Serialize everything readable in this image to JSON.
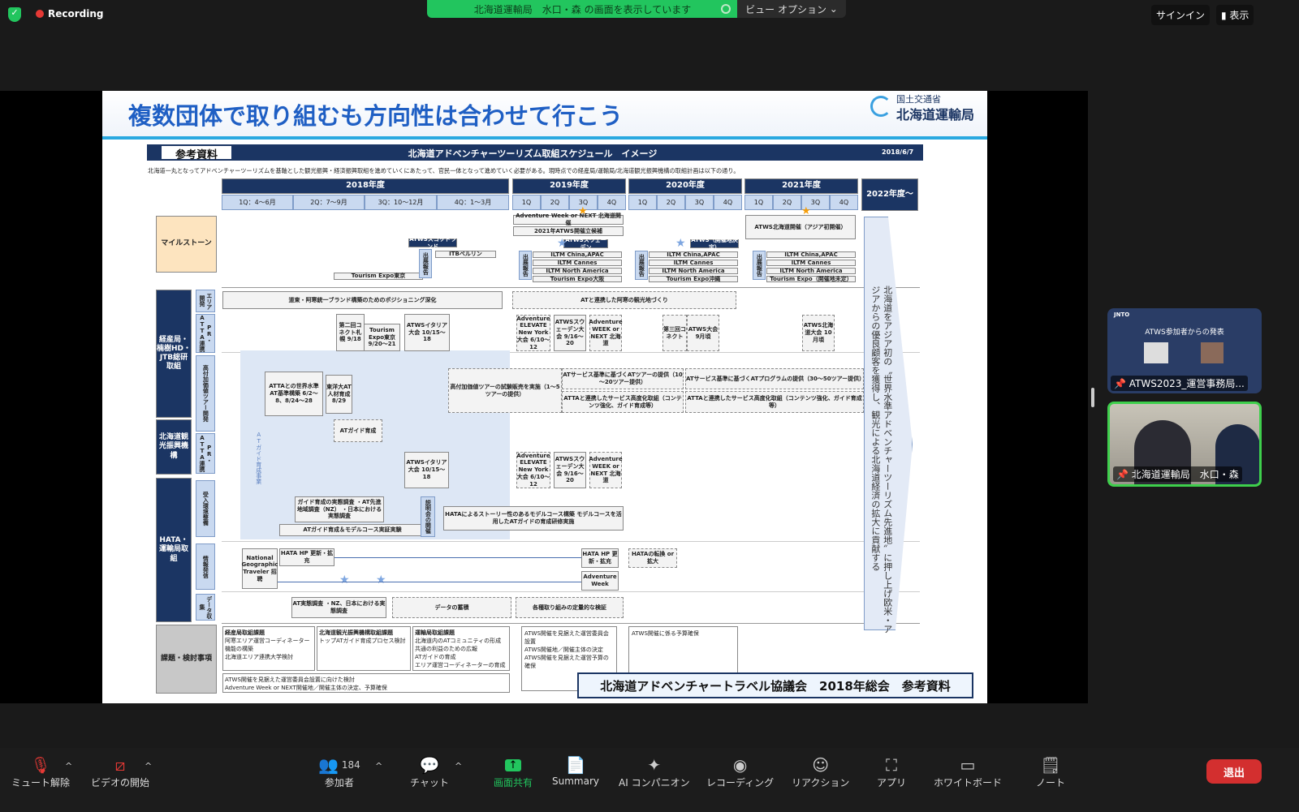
{
  "topbar": {
    "recording": "Recording",
    "sharing_banner": "北海道運輸局　水口・森 の画面を表示しています",
    "view_options": "ビュー オプション",
    "sign_in": "サインイン",
    "display": "表示"
  },
  "slide": {
    "title": "複数団体で取り組むも方向性は合わせて行こう",
    "logo_line1": "国土交通省",
    "logo_line2": "北海道運輸局",
    "tag": "参考資料",
    "header": "北海道アドベンチャーツーリズム取組スケジュール　イメージ",
    "date": "2018/6/7",
    "intro": "北海道一丸となってアドベンチャーツーリズムを基軸とした観光振興・経済振興取組を進めていくにあたって、官民一体となって進めていく必要がある。現時点での経産局/運輸局/北海道観光振興機構の取組計画は以下の通り。",
    "years": [
      "2018年度",
      "2019年度",
      "2020年度",
      "2021年度",
      "2022年度～"
    ],
    "q2018": [
      "1Q：4～6月",
      "2Q：7～9月",
      "3Q：10～12月",
      "4Q：1～3月"
    ],
    "quarters": [
      "1Q",
      "2Q",
      "3Q",
      "4Q"
    ],
    "rows": {
      "milestone": "マイルストーン",
      "meti": "経産局・楠樹HD・JTB総研取組",
      "hta": "北海道観光振興機構",
      "hata": "HATA・運輸局取組",
      "issues": "課題・検討事項"
    },
    "subrows": [
      "エリア開発",
      "PR・ATTA連携",
      "高付加価値ツアー開発",
      "PR・ATTA連携",
      "受入環境整備",
      "情報発信",
      "データ収集"
    ],
    "boxes": {
      "atws_scotland": "ATWSスコットランド",
      "jtb_berlin": "ITBベルリン",
      "expo_tokyo_top": "Tourism Expo東京",
      "exhibit": "出展報告",
      "aw_next": "Adventure Week or NEXT 北海道開催",
      "atws2021": "2021年ATWS開催立候補",
      "atws_sweden_top": "ATWSスウェーデン",
      "atws_decide": "ATWS（開催地決定）",
      "atws_hokkaido": "ATWS北海道開催（アジア初開催）",
      "iltm1": "ILTM China,APAC",
      "iltm2": "ILTM Cannes",
      "iltm3": "ILTM North America",
      "expo_osaka": "Tourism Expo大阪",
      "expo_okinawa": "Tourism Expo沖縄",
      "expo_tbd": "Tourism Expo（開催地未定）",
      "positioning": "道東・阿寒統一ブランド構築のためのポジショニング深化",
      "connect2": "第二回コネクト札幌 9/18",
      "expo_tokyo": "Tourism Expo東京 9/20～21",
      "atws_italy": "ATWSイタリア大会 10/15～18",
      "at_area": "ATと連携した阿寒の観光地づくり",
      "elevate": "Adventure ELEVATE New York大会 6/10～12",
      "atws_sweden": "ATWSスウェーデン大会 9/16～20",
      "aw_week": "Adventure WEEK or NEXT 北海道",
      "connect3": "第三回コネクト",
      "atws_sep": "ATWS大会 9月頃",
      "atws_hk": "ATWS北海道大会 10月頃",
      "atta_std": "ATTAとの世界水準AT基準構築 6/2～8、8/24～28",
      "toyo": "東洋大AT人材育成 8/29",
      "trial": "高付加価値ツアーの試験販売を実施（1～5ツアーの提供）",
      "svc1": "ATサービス基準に基づくATツアーの提供（10～20ツアー提供）",
      "svc2": "ATサービス基準に基づくATプログラムの提供（30～50ツアー提供）",
      "atta1": "ATTAと連携したサービス高度化取組（コンテンツ強化、ガイド育成等）",
      "atta2": "ATTAと連携したサービス高度化取組（コンテンツ強化、ガイド育成等）",
      "guide": "ATガイド育成",
      "guide_project": "ATガイド育成事業",
      "survey": "ガイド育成の実態調査 ・AT先進地域調査（NZ） ・日本における実態調査",
      "model_exp": "ATガイド育成＆モデルコース実証実験",
      "briefing": "説明会の開催",
      "hata_model": "HATAによるストーリー性のあるモデルコース構築 モデルコースを活用したATガイドの育成研修実施",
      "natgeo": "National Geographic Traveler 招聘",
      "hata_hp": "HATA HP 更新・拡充",
      "hata_hp2": "HATA HP 更新・拡充",
      "aw2": "Adventure Week",
      "hata_shift": "HATAの転換 or 拡大",
      "at_survey": "AT実態調査 ・NZ、日本における実態調査",
      "data_acc": "データの蓄積",
      "verify": "各種取り組みの定量的な検証"
    },
    "issues": {
      "meti_title": "経産局取組課題",
      "meti": [
        "阿寒エリア運営コーディネーター機能の構築",
        "北海道エリア連携大学検討"
      ],
      "hta_title": "北海道観光振興機構取組課題",
      "hta": [
        "トップATガイド育成プロセス検討"
      ],
      "mlit_title": "運輸局取組課題",
      "mlit": [
        "北海道内のATコミュニティの形成",
        "共通の利益のための広報",
        "ATガイドの育成",
        "エリア運営コーディネーターの育成"
      ],
      "all": [
        "ATWS開催を見据えた運営委員会設置に向けた検討",
        "Adventure Week or NEXT開催地／開催主体の決定、予算確保"
      ],
      "y2019": [
        "ATWS開催を見据えた運営委員会設置",
        "ATWS開催地／開催主体の決定",
        "ATWS開催を見据えた運営予算の確保"
      ],
      "y2020": [
        "ATWS開催に係る予算確保"
      ]
    },
    "arrow_text": "北海道をアジア初の〝世界水準アドベンチャーツーリズム先進地〟に押し上げ欧米・アジアからの優良顧客を獲得し、観光による北海道経済の拡大に貢献する",
    "footer": "北海道アドベンチャートラベル協議会　2018年総会　参考資料"
  },
  "participants": [
    {
      "name": "ATWS2023_運営事務局...",
      "content": "ATWS参加者からの発表",
      "brand": "JNTO"
    },
    {
      "name": "北海道運輸局　水口・森"
    }
  ],
  "toolbar": {
    "mute": "ミュート解除",
    "video": "ビデオの開始",
    "participants": "参加者",
    "participant_count": "184",
    "chat": "チャット",
    "share": "画面共有",
    "summary": "Summary",
    "ai": "AI コンパニオン",
    "record": "レコーディング",
    "reactions": "リアクション",
    "apps": "アプリ",
    "whiteboard": "ホワイトボード",
    "notes": "ノート",
    "leave": "退出"
  },
  "colors": {
    "share_green": "#22c55e",
    "navy": "#1b3563",
    "leave_red": "#d32f2f",
    "speaker_border": "#3ecf4c"
  }
}
